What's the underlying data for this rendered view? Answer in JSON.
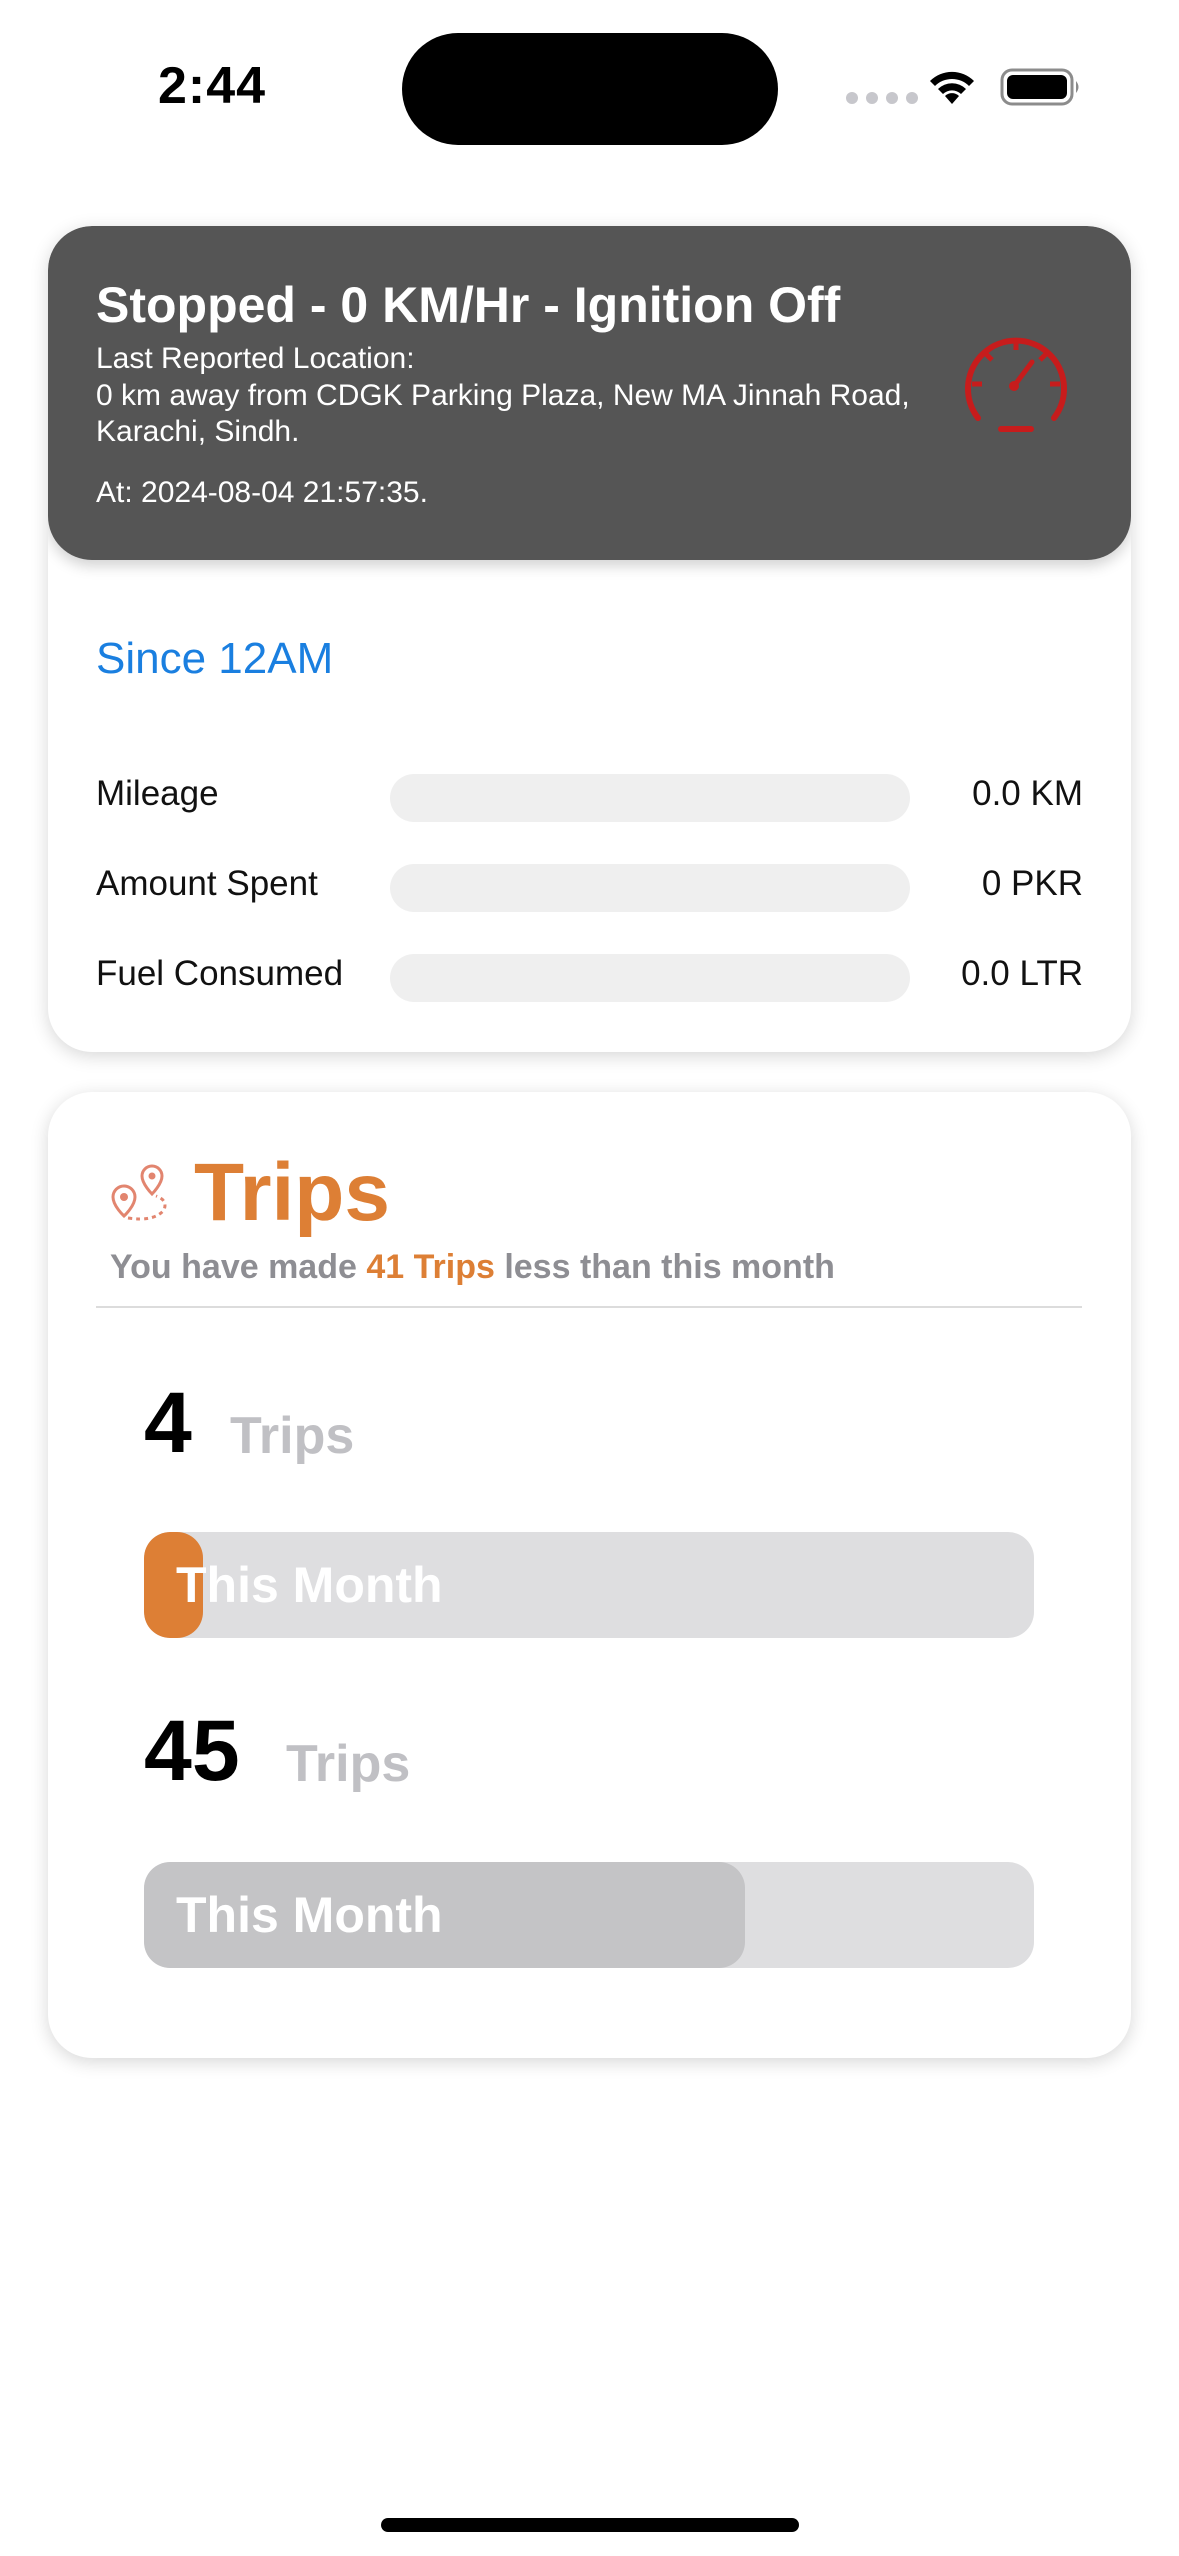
{
  "status_bar": {
    "time": "2:44",
    "icons": [
      "signal-dots-icon",
      "wifi-icon",
      "battery-icon"
    ]
  },
  "vehicle_status": {
    "title": "Stopped - 0 KM/Hr - Ignition Off",
    "location_label": "Last Reported Location:",
    "location_text": "0 km away from CDGK Parking Plaza, New MA Jinnah Road, Karachi, Sindh.",
    "timestamp": "At: 2024-08-04 21:57:35.",
    "icon": "speedometer-icon",
    "icon_color": "#c71c1c",
    "header_color": "#555555"
  },
  "summary": {
    "since_label": "Since 12AM",
    "accent_color": "#1a7fe0",
    "metrics": [
      {
        "label": "Mileage",
        "value": "0.0 KM",
        "progress": 0
      },
      {
        "label": "Amount Spent",
        "value": "0 PKR",
        "progress": 0
      },
      {
        "label": "Fuel Consumed",
        "value": "0.0 LTR",
        "progress": 0
      }
    ]
  },
  "trips": {
    "title": "Trips",
    "icon": "route-pins-icon",
    "accent_color": "#dd7f35",
    "subtitle_prefix": "You have made ",
    "subtitle_highlight": "41 Trips",
    "subtitle_suffix": " less than this month",
    "rows": [
      {
        "count": "4",
        "unit": "Trips",
        "bar_label": "This Month",
        "progress": 0.066,
        "fill_color": "#dd7f35"
      },
      {
        "count": "45",
        "unit": "Trips",
        "bar_label": "This Month",
        "progress": 0.675,
        "fill_color": "#c4c4c6"
      }
    ]
  }
}
